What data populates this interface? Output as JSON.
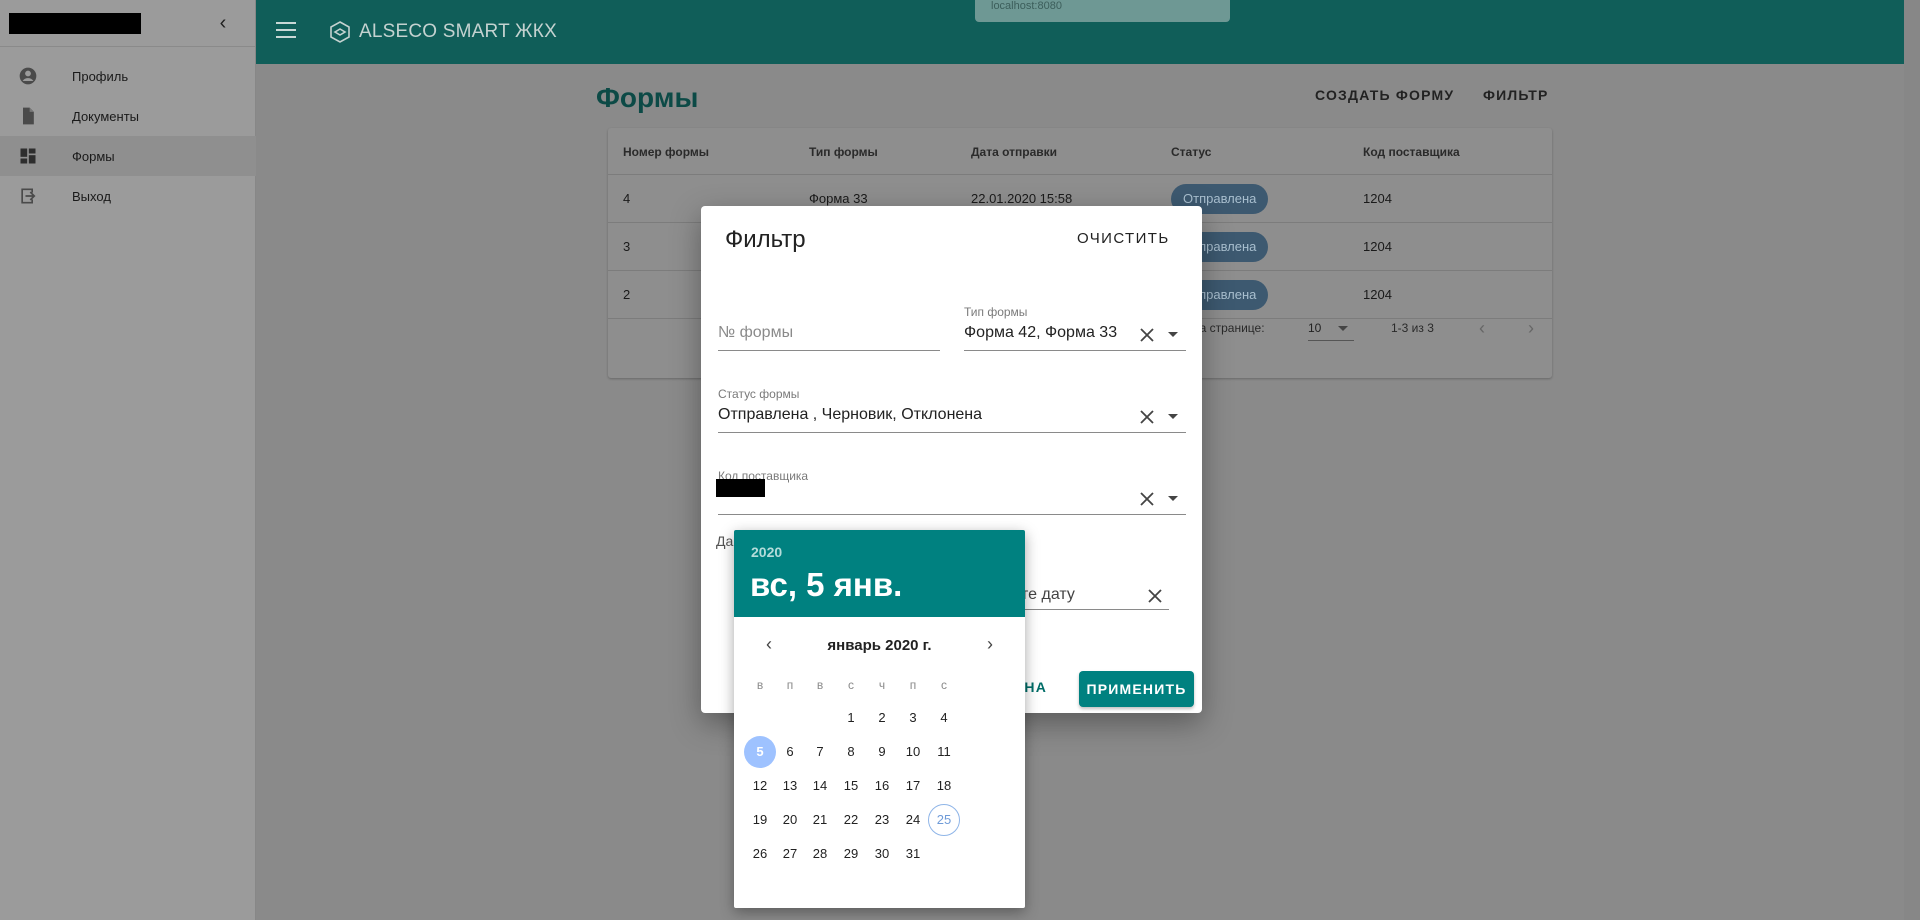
{
  "browser": {
    "url": "localhost:8080"
  },
  "app": {
    "brand": "ALSECO SMART ЖКХ"
  },
  "sidebar": {
    "items": [
      {
        "label": "Профиль",
        "icon": "account-circle-icon"
      },
      {
        "label": "Документы",
        "icon": "document-icon"
      },
      {
        "label": "Формы",
        "icon": "dashboard-icon",
        "active": true
      },
      {
        "label": "Выход",
        "icon": "exit-icon"
      }
    ]
  },
  "page": {
    "title": "Формы",
    "create_label": "СОЗДАТЬ ФОРМУ",
    "filter_label": "ФИЛЬТР"
  },
  "table": {
    "columns": [
      "Номер формы",
      "Тип формы",
      "Дата отправки",
      "Статус",
      "Код поставщика"
    ],
    "rows": [
      {
        "number": "4",
        "type": "Форма 33",
        "date": "22.01.2020 15:58",
        "status": "Отправлена",
        "code": "1204"
      },
      {
        "number": "3",
        "status": "Отправлена",
        "code": "1204"
      },
      {
        "number": "2",
        "status": "Отправлена",
        "code": "1204"
      }
    ],
    "pagination": {
      "rows_per_page_label": "на странице:",
      "rows_per_page": "10",
      "range": "1-3 из 3"
    }
  },
  "filter_dialog": {
    "title": "Фильтр",
    "clear_label": "ОЧИСТИТЬ",
    "form_number_placeholder": "№ формы",
    "form_type_label": "Тип формы",
    "form_type_value": "Форма 42, Форма 33",
    "status_label": "Статус формы",
    "status_value": "Отправлена , Черновик, Отклонена",
    "supplier_label": "Код поставщика",
    "date_label_partial": "Да",
    "date_placeholder_partial": "те дату",
    "cancel_partial": "МЕНА",
    "apply_label": "ПРИМЕНИТЬ"
  },
  "date_picker": {
    "year": "2020",
    "selected_label": "вс, 5 янв.",
    "month_label": "январь 2020 г.",
    "weekdays": [
      "в",
      "п",
      "в",
      "с",
      "ч",
      "п",
      "с"
    ],
    "weeks": [
      [
        "",
        "",
        "",
        "1",
        "2",
        "3",
        "4"
      ],
      [
        "5",
        "6",
        "7",
        "8",
        "9",
        "10",
        "11"
      ],
      [
        "12",
        "13",
        "14",
        "15",
        "16",
        "17",
        "18"
      ],
      [
        "19",
        "20",
        "21",
        "22",
        "23",
        "24",
        "25"
      ],
      [
        "26",
        "27",
        "28",
        "29",
        "30",
        "31",
        ""
      ]
    ],
    "selected_day": "5",
    "today_day": "25",
    "accent_color": "#008180"
  }
}
